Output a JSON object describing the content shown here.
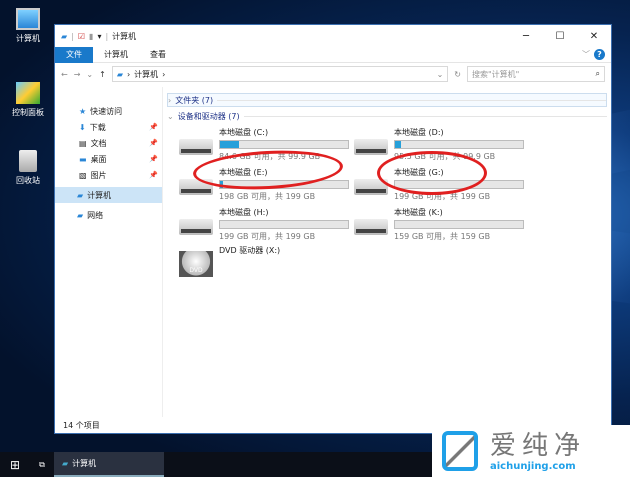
{
  "desktop": {
    "icons": [
      {
        "label": "计算机"
      },
      {
        "label": "控制面板"
      },
      {
        "label": "回收站"
      }
    ]
  },
  "window": {
    "title": "计算机",
    "tabs": [
      "文件",
      "计算机",
      "查看"
    ],
    "address": "计算机",
    "search_placeholder": "搜索\"计算机\"",
    "nav": [
      {
        "label": "快速访问"
      },
      {
        "label": "下载"
      },
      {
        "label": "文档"
      },
      {
        "label": "桌面"
      },
      {
        "label": "图片"
      },
      {
        "label": "计算机"
      },
      {
        "label": "网络"
      }
    ],
    "groups": {
      "folders": "文件夹 (7)",
      "devices": "设备和驱动器 (7)"
    },
    "drives": [
      {
        "name": "本地磁盘 (C:)",
        "info": "84.6 GB 可用，共 99.9 GB",
        "used": 0.15
      },
      {
        "name": "本地磁盘 (D:)",
        "info": "95.5 GB 可用，共 99.9 GB",
        "used": 0.05
      },
      {
        "name": "本地磁盘 (E:)",
        "info": "198 GB 可用，共 199 GB",
        "used": 0.01
      },
      {
        "name": "本地磁盘 (G:)",
        "info": "199 GB 可用，共 199 GB",
        "used": 0.0
      },
      {
        "name": "本地磁盘 (H:)",
        "info": "199 GB 可用，共 199 GB",
        "used": 0.0
      },
      {
        "name": "本地磁盘 (K:)",
        "info": "159 GB 可用，共 159 GB",
        "used": 0.0
      }
    ],
    "dvd": "DVD 驱动器 (X:)",
    "status": "14 个项目"
  },
  "taskbar": {
    "app": "计算机"
  },
  "watermark": {
    "text": "爱纯净",
    "url": "aichunjing.com"
  }
}
